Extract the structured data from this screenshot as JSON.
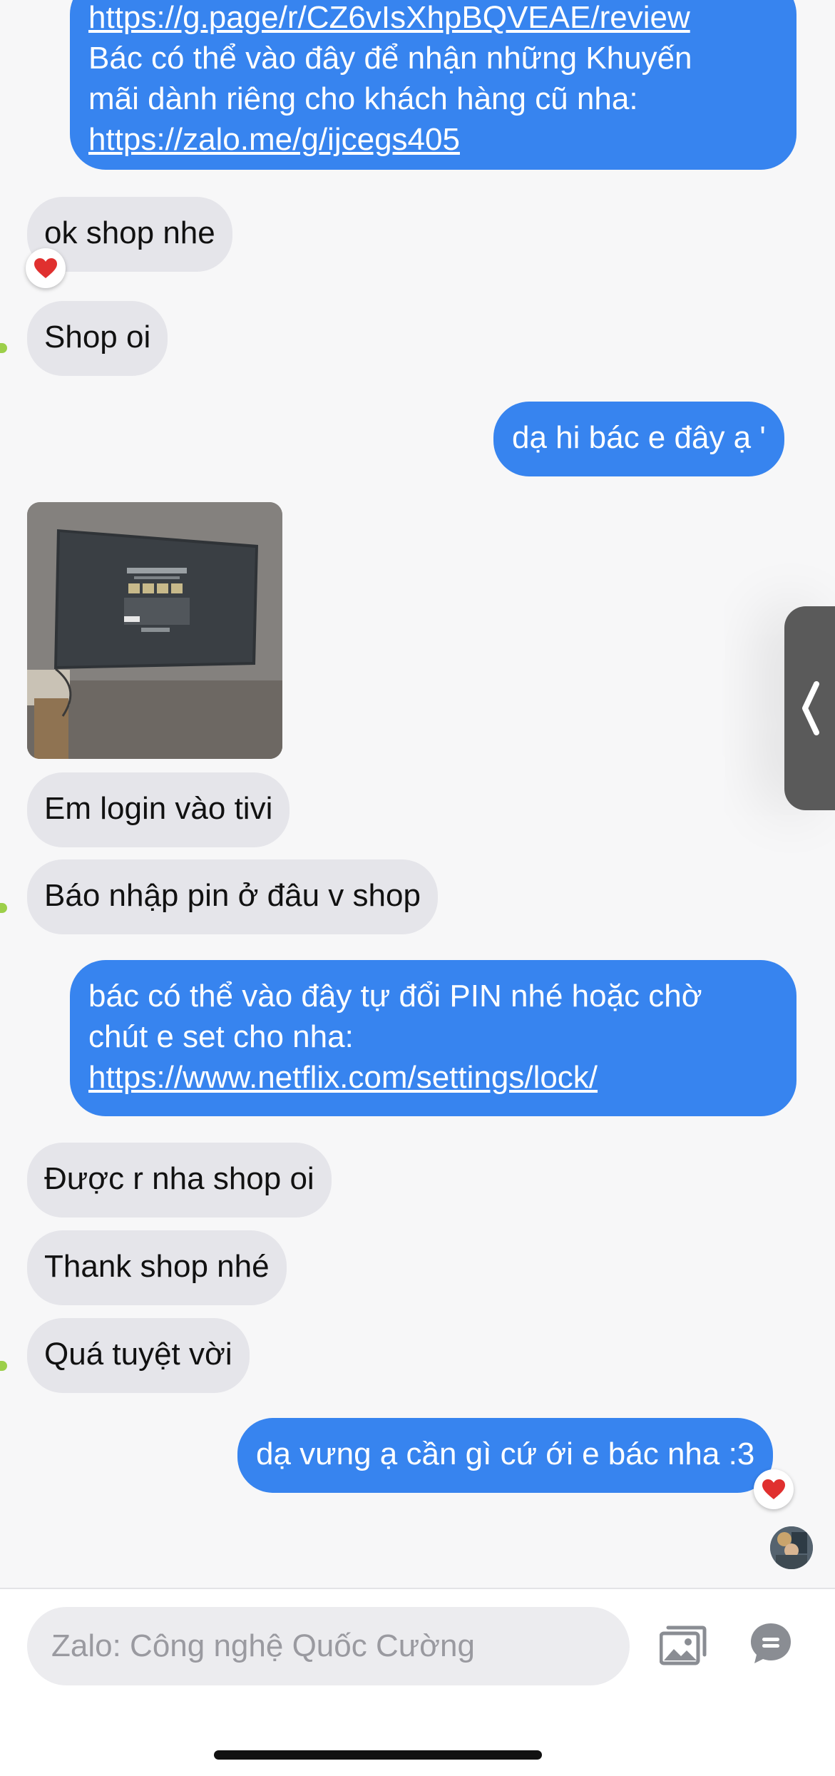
{
  "messages": {
    "top_out": {
      "line0": "https://g.page/r/CZ6vIsXhpBQVEAE/review",
      "line1": "Bác có thể vào đây để nhận những Khuyến",
      "line2": "mãi dành riêng cho khách hàng cũ nha:",
      "link": "https://zalo.me/g/ijcegs405"
    },
    "in_ok": "ok shop nhe",
    "in_shop_oi": "Shop oi",
    "out_hi": "dạ hi bác e đây ạ '",
    "in_login": "Em login vào tivi",
    "in_pin": "Báo nhập pin ở đâu v shop",
    "out_pin": {
      "line1": "bác có thể vào đây tự đổi PIN nhé hoặc chờ",
      "line2": "chút e set cho nha:",
      "link": "https://www.netflix.com/settings/lock/"
    },
    "in_duoc": "Được r nha shop oi",
    "in_thank": "Thank shop nhé",
    "in_qua": "Quá tuyệt vời",
    "out_final": "dạ vưng ạ cần gì cứ ới e bác nha :3"
  },
  "reactions": {
    "icon": "heart-icon",
    "color": "#e0302f"
  },
  "composer": {
    "placeholder": "Zalo: Công nghệ Quốc Cường",
    "gallery_icon": "image-gallery-icon",
    "sticker_icon": "chat-bubble-icon"
  },
  "colors": {
    "outgoing": "#3784ef",
    "incoming": "#e5e5ea",
    "background": "#f7f7f8"
  }
}
